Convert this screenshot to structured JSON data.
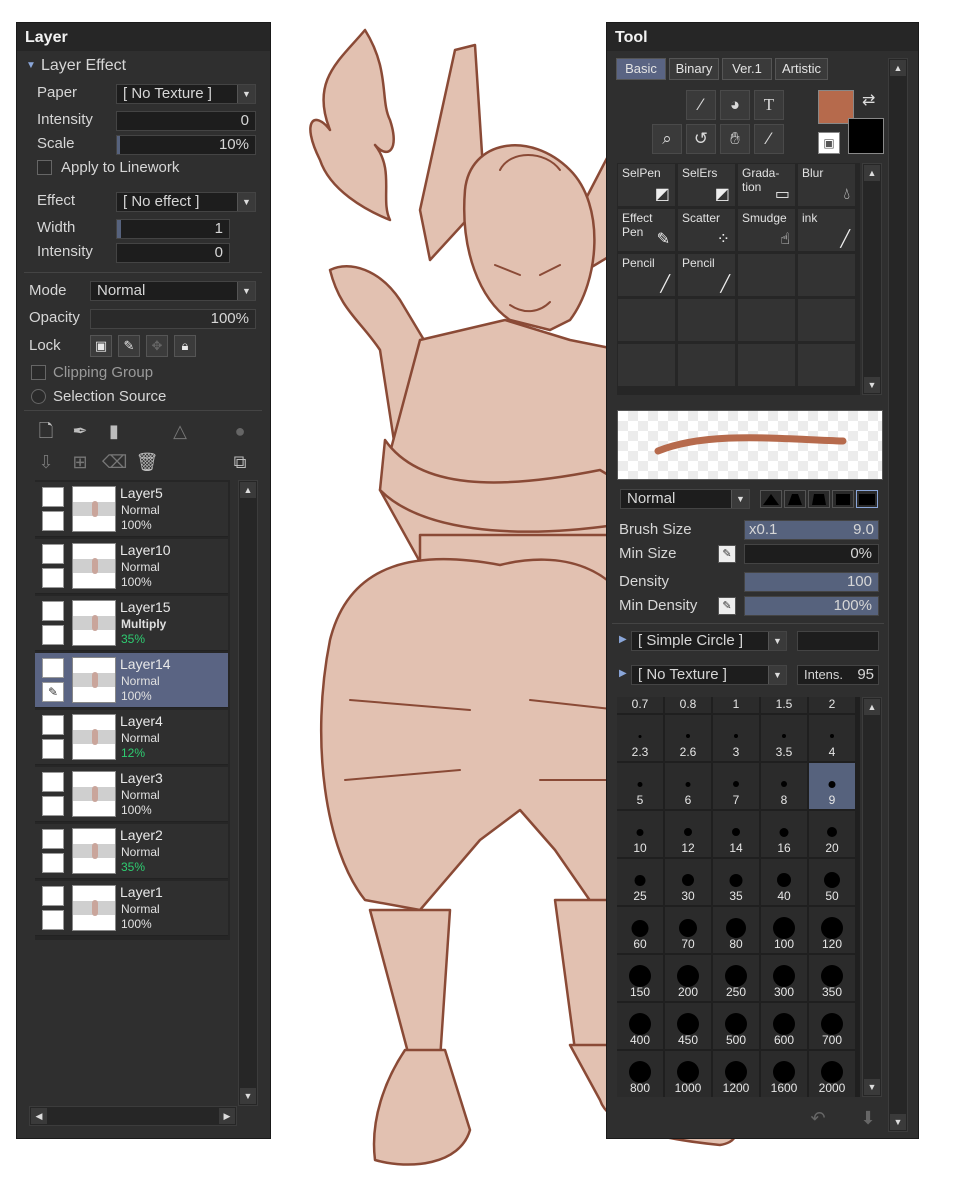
{
  "layer_panel": {
    "title": "Layer",
    "layer_effect": "Layer Effect",
    "paper_label": "Paper",
    "paper_value": "[ No Texture ]",
    "intensity_label": "Intensity",
    "intensity_value": "0",
    "scale_label": "Scale",
    "scale_value": "10%",
    "scale_fraction": 0.1,
    "apply_linework": "Apply to Linework",
    "effect_label": "Effect",
    "effect_value": "[ No effect ]",
    "width_label": "Width",
    "width_value": "1",
    "intensity2_label": "Intensity",
    "intensity2_value": "0",
    "mode_label": "Mode",
    "mode_value": "Normal",
    "opacity_label": "Opacity",
    "opacity_value": "100%",
    "lock_label": "Lock",
    "clipping_group": "Clipping Group",
    "selection_source": "Selection Source",
    "layers": [
      {
        "name": "Layer5",
        "mode": "Normal",
        "opacity": "100%"
      },
      {
        "name": "Layer10",
        "mode": "Normal",
        "opacity": "100%"
      },
      {
        "name": "Layer15",
        "mode": "Multiply",
        "opacity": "35%"
      },
      {
        "name": "Layer14",
        "mode": "Normal",
        "opacity": "100%"
      },
      {
        "name": "Layer4",
        "mode": "Normal",
        "opacity": "12%"
      },
      {
        "name": "Layer3",
        "mode": "Normal",
        "opacity": "100%"
      },
      {
        "name": "Layer2",
        "mode": "Normal",
        "opacity": "35%"
      },
      {
        "name": "Layer1",
        "mode": "Normal",
        "opacity": "100%"
      }
    ]
  },
  "tool_panel": {
    "title": "Tool",
    "tabs": [
      "Basic",
      "Binary",
      "Ver.1",
      "Artistic"
    ],
    "tools": [
      {
        "label": "SelPen",
        "icon": "selpen-icon"
      },
      {
        "label": "SelErs",
        "icon": "selers-icon"
      },
      {
        "label": "Grada-\ntion",
        "icon": "gradation-icon"
      },
      {
        "label": "Blur",
        "icon": "blur-icon"
      },
      {
        "label": "Effect\nPen",
        "icon": "effect-pen-icon"
      },
      {
        "label": "Scatter",
        "icon": "scatter-icon"
      },
      {
        "label": "Smudge",
        "icon": "smudge-icon"
      },
      {
        "label": "ink",
        "icon": "ink-icon"
      },
      {
        "label": "Pencil",
        "icon": "pencil-icon"
      },
      {
        "label": "Pencil",
        "icon": "pencil-icon"
      }
    ],
    "blend_value": "Normal",
    "brush_size_label": "Brush Size",
    "brush_size_mult": "x0.1",
    "brush_size_value": "9.0",
    "min_size_label": "Min Size",
    "min_size_value": "0%",
    "density_label": "Density",
    "density_value": "100",
    "min_density_label": "Min Density",
    "min_density_value": "100%",
    "brush_shape": "[ Simple Circle ]",
    "texture": "[ No Texture ]",
    "intens_label": "Intens.",
    "intens_value": "95",
    "primary_color": "#b66a4c",
    "secondary_color": "#000000",
    "brush_sizes": [
      "0.7",
      "0.8",
      "1",
      "1.5",
      "2",
      "2.3",
      "2.6",
      "3",
      "3.5",
      "4",
      "5",
      "6",
      "7",
      "8",
      "9",
      "10",
      "12",
      "14",
      "16",
      "20",
      "25",
      "30",
      "35",
      "40",
      "50",
      "60",
      "70",
      "80",
      "100",
      "120",
      "150",
      "200",
      "250",
      "300",
      "350",
      "400",
      "450",
      "500",
      "600",
      "700",
      "800",
      "1000",
      "1200",
      "1600",
      "2000"
    ],
    "selected_size": "9"
  },
  "colors": {
    "panel_bg": "#2f2f2f",
    "selection": "#5a6483",
    "canvas_fill": "#e2c1b1",
    "line_color": "#8a4a36"
  }
}
